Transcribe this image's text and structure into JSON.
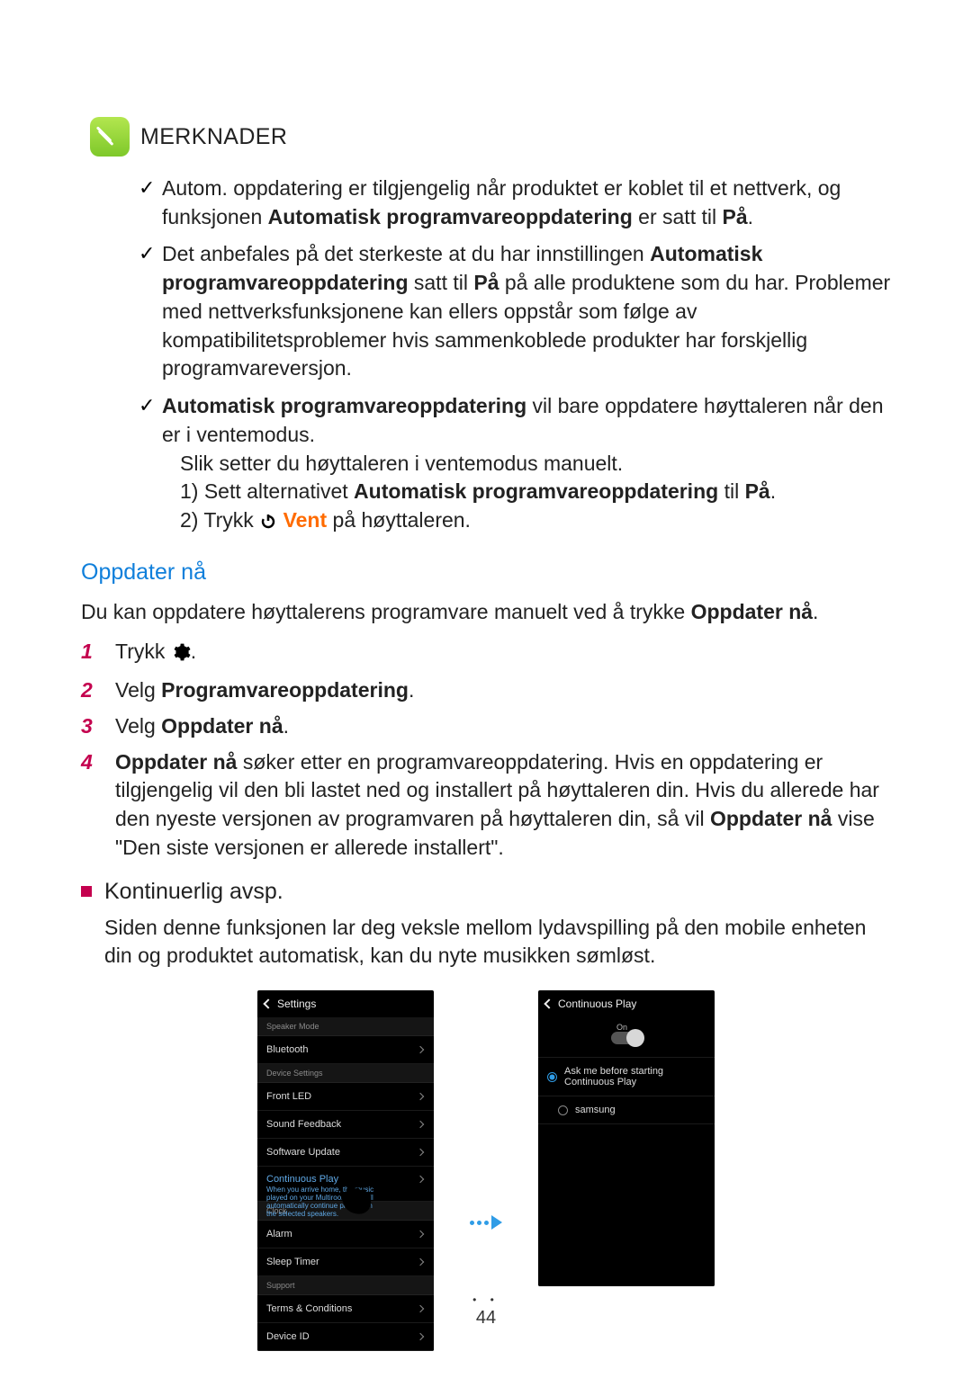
{
  "notes": {
    "heading": "MERKNADER",
    "items": [
      {
        "pre": "Autom. oppdatering er tilgjengelig når produktet er koblet til et nettverk, og funksjonen ",
        "bold1": "Automatisk programvareoppdatering",
        "mid": " er satt til ",
        "bold2": "På",
        "post": "."
      },
      {
        "pre": "Det anbefales på det sterkeste at du har innstillingen ",
        "bold1": "Automatisk programvareoppdatering",
        "mid": " satt til ",
        "bold2": "På",
        "post": " på alle produktene som du har. Problemer med nettverksfunksjonene kan ellers oppstår som følge av kompatibilitetsproblemer hvis sammenkoblede produkter har forskjellig programvareversjon."
      },
      {
        "bold_lead": "Automatisk programvareoppdatering",
        "after_lead": " vil bare oppdatere høyttaleren når den er i ventemodus.",
        "line2": "Slik setter du høyttaleren i ventemodus manuelt.",
        "sub1_pre": "1) Sett alternativet ",
        "sub1_b": "Automatisk programvareoppdatering",
        "sub1_mid": " til ",
        "sub1_b2": "På",
        "sub1_post": ".",
        "sub2_pre": "2) Trykk ",
        "sub2_vent": "Vent",
        "sub2_post": " på høyttaleren."
      }
    ]
  },
  "oppdater": {
    "title": "Oppdater nå",
    "intro_pre": "Du kan oppdatere høyttalerens programvare manuelt ved å trykke ",
    "intro_bold": "Oppdater nå",
    "intro_post": ".",
    "steps": {
      "s1": {
        "num": "1",
        "text_pre": "Trykk ",
        "text_post": "."
      },
      "s2": {
        "num": "2",
        "text_pre": "Velg ",
        "bold": "Programvareoppdatering",
        "text_post": "."
      },
      "s3": {
        "num": "3",
        "text_pre": "Velg ",
        "bold": "Oppdater nå",
        "text_post": "."
      },
      "s4": {
        "num": "4",
        "b1": "Oppdater nå",
        "t1": " søker etter en programvareoppdatering. Hvis en oppdatering er tilgjengelig vil den bli lastet ned og installert på høyttaleren din. Hvis du allerede har den nyeste versjonen av programvaren på høyttaleren din, så vil ",
        "b2": "Oppdater nå",
        "t2": " vise \"Den siste versjonen er allerede installert\"."
      }
    }
  },
  "kontinuerlig": {
    "heading": "Kontinuerlig avsp.",
    "body": "Siden denne funksjonen lar deg veksle mellom lydavspilling på den mobile enheten din og produktet automatisk, kan du nyte musikken sømløst."
  },
  "phone1": {
    "back": "Settings",
    "secSpeaker": "Speaker Mode",
    "bluetooth": "Bluetooth",
    "secDevice": "Device Settings",
    "frontled": "Front LED",
    "soundfb": "Sound Feedback",
    "swupdate": "Software Update",
    "contplay": "Continuous Play",
    "contdesc": "When you arrive home, the music played on your Multiroom app will automatically continue playing on the selected speakers.",
    "secClock": "Clock",
    "alarm": "Alarm",
    "sleep": "Sleep Timer",
    "secSupport": "Support",
    "terms": "Terms & Conditions",
    "deviceid": "Device ID"
  },
  "phone2": {
    "back": "Continuous Play",
    "onlabel": "On",
    "ask": "Ask me before starting Continuous Play",
    "samsung": "samsung"
  },
  "footer": {
    "page": "44"
  }
}
